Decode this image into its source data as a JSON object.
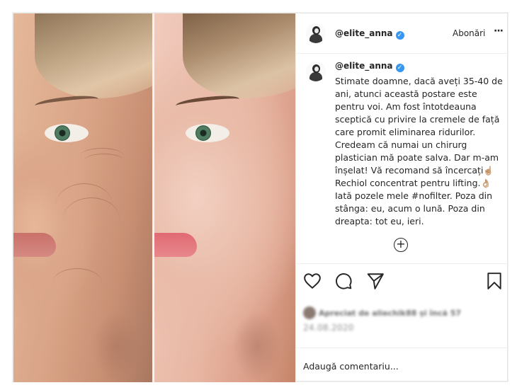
{
  "post": {
    "username": "@elite_anna",
    "verified_glyph": "✓",
    "follow_label": "Abonări",
    "more_label": "···",
    "caption_username": "@elite_anna",
    "caption_text": "Stimate doamne, dacă aveți 35-40 de ani, atunci această postare este pentru voi. Am fost întotdeauna sceptică cu privire la cremele de față care promit eliminarea ridurilor. Credeam că numai un chirurg plastician mă poate salva. Dar m-am înșelat! Vă recomand să încercați",
    "caption_emoji_1": "☝🏼",
    "caption_text_2": "Rechiol concentrat pentru lifting.",
    "caption_emoji_2": "👌🏼",
    "caption_text_3": "Iată pozele mele #nofilter. Poza din stânga: eu, acum o lună. Poza din dreapta: tot eu, ieri.",
    "load_more_glyph": "+",
    "likes_text": "Apreciat de aliechik88 și încă 57",
    "date": "24.08.2020",
    "comment_placeholder": "Adaugă comentariu..."
  },
  "icons": {
    "like": "heart-icon",
    "comment": "comment-bubble-icon",
    "share": "paper-plane-icon",
    "save": "bookmark-icon"
  },
  "colors": {
    "verified_blue": "#3897f0",
    "border": "#efefef",
    "text": "#262626"
  }
}
